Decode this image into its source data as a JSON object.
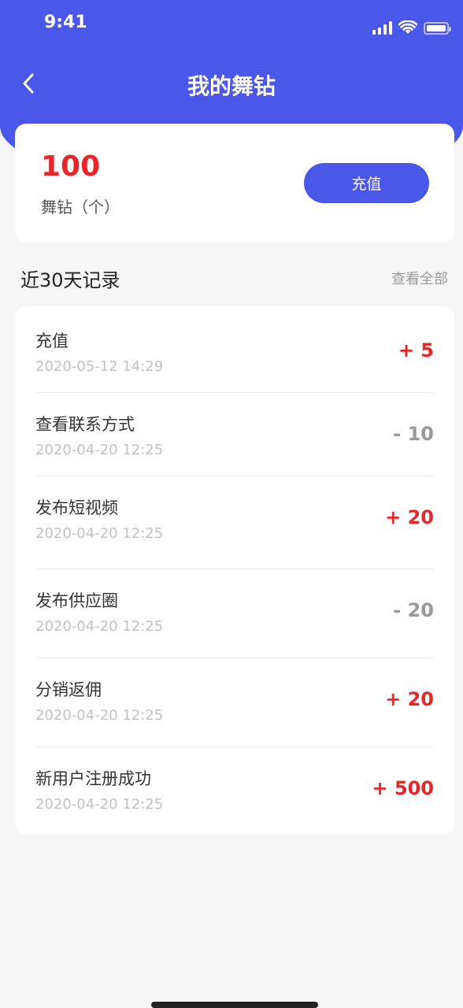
{
  "status_bar": {
    "time": "9:41"
  },
  "nav": {
    "title": "我的舞钻"
  },
  "balance": {
    "value": "100",
    "unit": "舞钻（个）",
    "recharge_label": "充值"
  },
  "records_section": {
    "title": "近30天记录",
    "view_all_label": "查看全部"
  },
  "records": [
    {
      "title": "充值",
      "time": "2020-05-12 14:29",
      "amount": "+ 5",
      "type": "positive"
    },
    {
      "title": "查看联系方式",
      "time": "2020-04-20 12:25",
      "amount": "- 10",
      "type": "negative"
    },
    {
      "title": "发布短视频",
      "time": "2020-04-20 12:25",
      "amount": "+ 20",
      "type": "positive"
    },
    {
      "title": "发布供应圈",
      "time": "2020-04-20 12:25",
      "amount": "- 20",
      "type": "negative"
    },
    {
      "title": "分销返佣",
      "time": "2020-04-20 12:25",
      "amount": "+ 20",
      "type": "positive"
    },
    {
      "title": "新用户注册成功",
      "time": "2020-04-20 12:25",
      "amount": "+ 500",
      "type": "positive"
    }
  ],
  "colors": {
    "primary": "#4b57e8",
    "positive": "#e8262a",
    "negative": "#999999"
  }
}
